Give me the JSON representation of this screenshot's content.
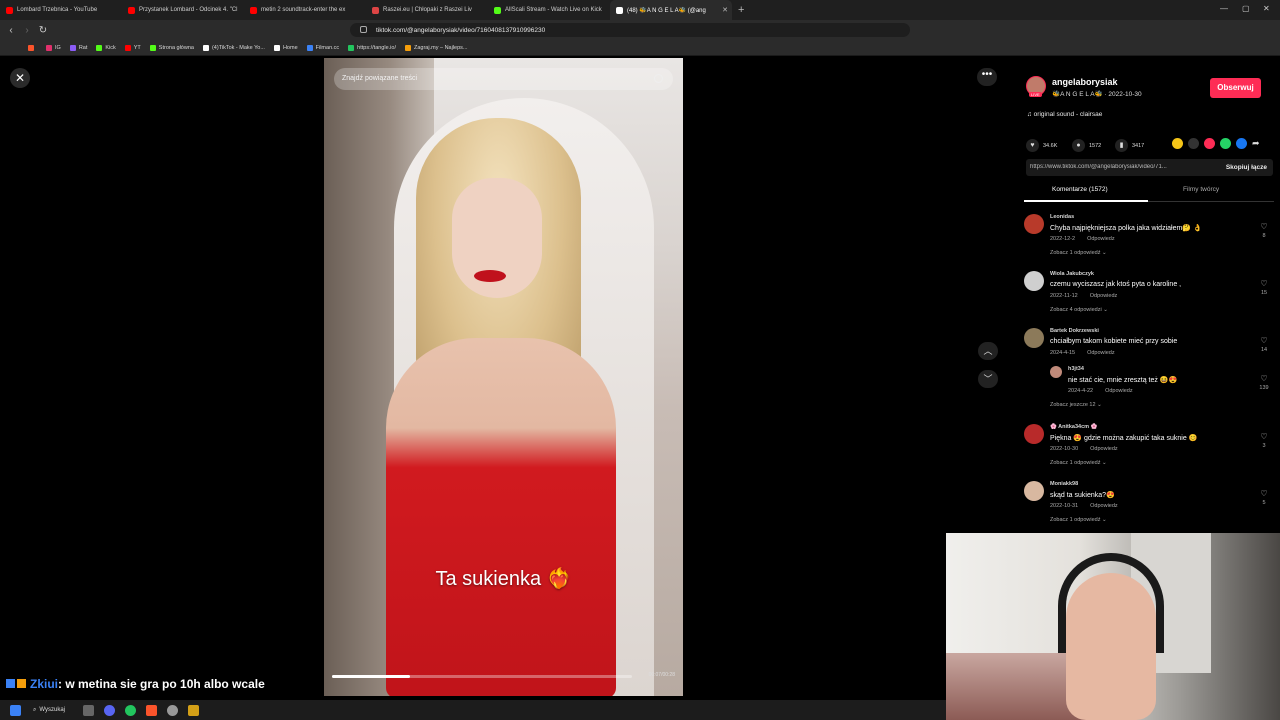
{
  "browser": {
    "tabs": [
      {
        "title": "Lombard Trzebnica - YouTube",
        "favicon_color": "#ff0000"
      },
      {
        "title": "Przystanek Lombard - Odcinek 4. \"Cl",
        "favicon_color": "#ff0000"
      },
      {
        "title": "metin 2 soundtrack-enter the ex",
        "favicon_color": "#ff0000"
      },
      {
        "title": "Raszei.eu | Chłopaki z Raszei Liv",
        "favicon_color": "#d44"
      },
      {
        "title": "AllScali Stream - Watch Live on Kick",
        "favicon_color": "#53fc18"
      },
      {
        "title": "(48) 🐝A N G E L A🐝 (@ang",
        "favicon_color": "#fff",
        "active": true
      }
    ],
    "new_tab": "+",
    "url": "tiktok.com/@angelaborysiak/video/7160408137910996230",
    "bookmarks": [
      {
        "label": "IG",
        "color": "#e1306c"
      },
      {
        "label": "Rat",
        "color": "#8b5cf6"
      },
      {
        "label": "Kick",
        "color": "#53fc18"
      },
      {
        "label": "YT",
        "color": "#ff0000"
      },
      {
        "label": "Strona główna",
        "color": "#53fc18"
      },
      {
        "label": "(4)TikTok - Make Yo...",
        "color": "#ffffff"
      },
      {
        "label": "Home",
        "color": "#ffffff"
      },
      {
        "label": "Filman.cc",
        "color": "#3b82f6"
      },
      {
        "label": "https://tangle.io/",
        "color": "#22c55e"
      },
      {
        "label": "Zagraj.my – Najleps...",
        "color": "#f59e0b"
      }
    ]
  },
  "video": {
    "search_placeholder": "Znajdź powiązane treści",
    "caption": "Ta sukienka",
    "caption_emoji": "❤️‍🔥",
    "progress": 0.26,
    "timecode": "00:07/00:28"
  },
  "post": {
    "author": "angelaborysiak",
    "author_sub": "🐝A N G E L A🐝 · 2022-10-30",
    "live_badge": "LIVE",
    "follow": "Obserwuj",
    "music": "♫  original sound - clairsae",
    "likes": "34.6K",
    "comments": "1572",
    "saves": "3417",
    "link": "https://www.tiktok.com/@angelaborysiak/video/71...",
    "copy_link": "Skopiuj łącze",
    "tab_comments": "Komentarze (1572)",
    "tab_creator": "Filmy twórcy"
  },
  "comments": [
    {
      "user": "Leonidas",
      "text": "Chyba najpiękniejsza polka jaka widziałem🤔 👌",
      "date": "2022-12-2",
      "reply": "Odpowiedz",
      "more": "Zobacz 1 odpowiedź ⌄",
      "likes": "8",
      "avatar_color": "#b83a2a"
    },
    {
      "user": "Wiola Jakubczyk",
      "text": "czemu wyciszasz jak ktoś pyta o karoline ,",
      "date": "2022-11-12",
      "reply": "Odpowiedz",
      "more": "Zobacz 4 odpowiedzi ⌄",
      "likes": "15",
      "avatar_color": "#cfcfcf"
    },
    {
      "user": "Bartek Dokrzewski",
      "text": "chciałbym takom kobiete mieć przy sobie",
      "date": "2024-4-15",
      "reply": "Odpowiedz",
      "more": "",
      "likes": "14",
      "avatar_color": "#8c7a5a"
    },
    {
      "user": "h3jt34",
      "text": "nie stać cie, mnie zresztą też 😆😍",
      "date": "2024-4-22",
      "reply": "Odpowiedz",
      "more": "Zobacz jeszcze 12 ⌄",
      "likes": "139",
      "avatar_color": "#c08a7a"
    },
    {
      "user": "🌸 Anitka34cm 🌸",
      "text": "Piękna 😍 gdzie można zakupić taka suknie 😊",
      "date": "2022-10-30",
      "reply": "Odpowiedz",
      "more": "Zobacz 1 odpowiedź ⌄",
      "likes": "3",
      "avatar_color": "#b82a2a"
    },
    {
      "user": "Moniakk98",
      "text": "skąd ta sukienka?😍",
      "date": "2022-10-31",
      "reply": "Odpowiedz",
      "more": "Zobacz 1 odpowiedź ⌄",
      "likes": "5",
      "avatar_color": "#d8b8a0"
    }
  ],
  "overlay": {
    "chat_user": "Zkiui",
    "chat_text": ": w metina sie gra po 10h albo wcale"
  },
  "taskbar": {
    "search": "Wyszukaj"
  },
  "colors": {
    "accent": "#fe2c55"
  }
}
